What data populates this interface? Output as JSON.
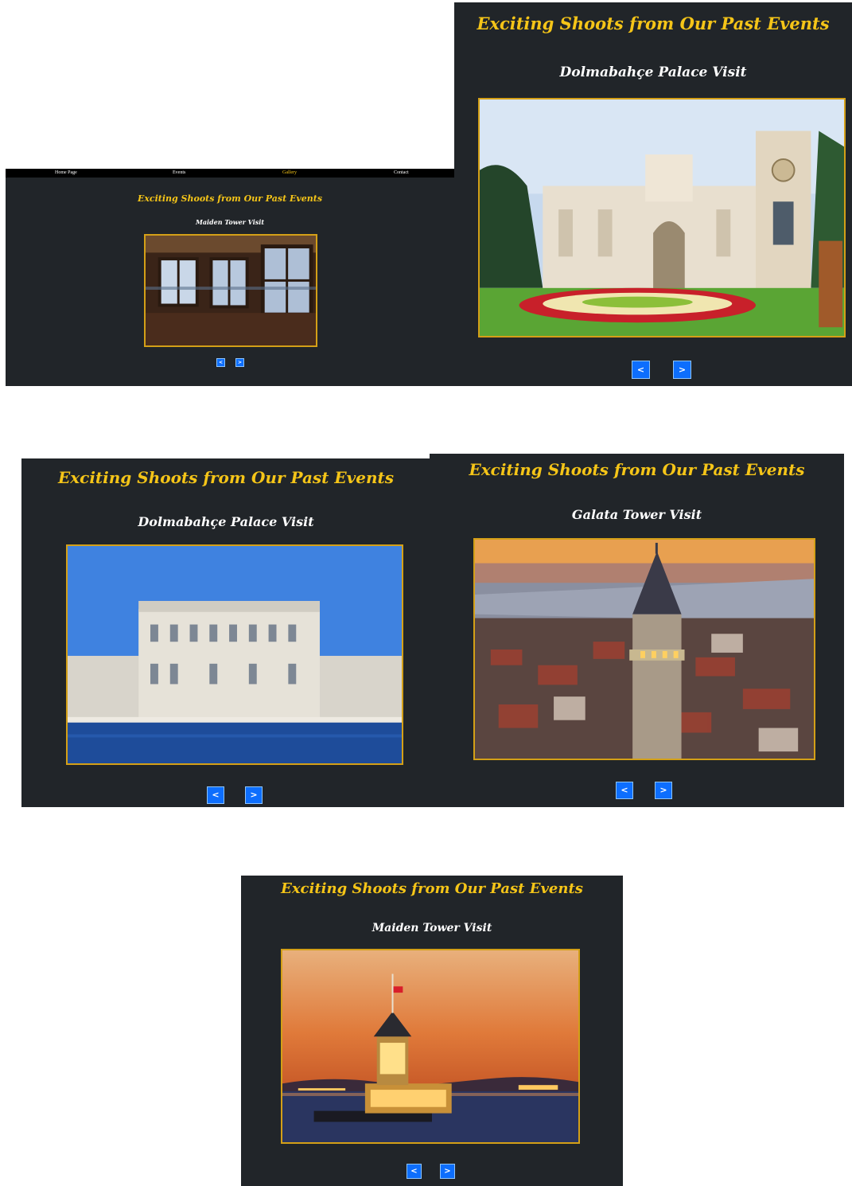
{
  "nav": {
    "home": "Home Page",
    "events": "Events",
    "gallery": "Gallery",
    "contact": "Contact"
  },
  "gallery": {
    "heading": "Exciting Shoots from Our Past Events",
    "prev_label": "<",
    "next_label": ">",
    "slides": [
      {
        "caption": "Maiden Tower Visit",
        "image": "maiden-tower-interior-photo"
      },
      {
        "caption": "Dolmabahçe Palace Visit",
        "image": "dolmabahce-gate-photo"
      },
      {
        "caption": "Dolmabahçe Palace Visit",
        "image": "dolmabahce-seafront-photo"
      },
      {
        "caption": "Galata Tower Visit",
        "image": "galata-tower-aerial-photo"
      },
      {
        "caption": "Maiden Tower Visit",
        "image": "maiden-tower-sunset-photo"
      }
    ]
  },
  "colors": {
    "panel_bg": "#212529",
    "heading": "#f5c518",
    "frame_border": "#d4a017",
    "button": "#0d6efd",
    "nav_active": "#f5c518"
  }
}
